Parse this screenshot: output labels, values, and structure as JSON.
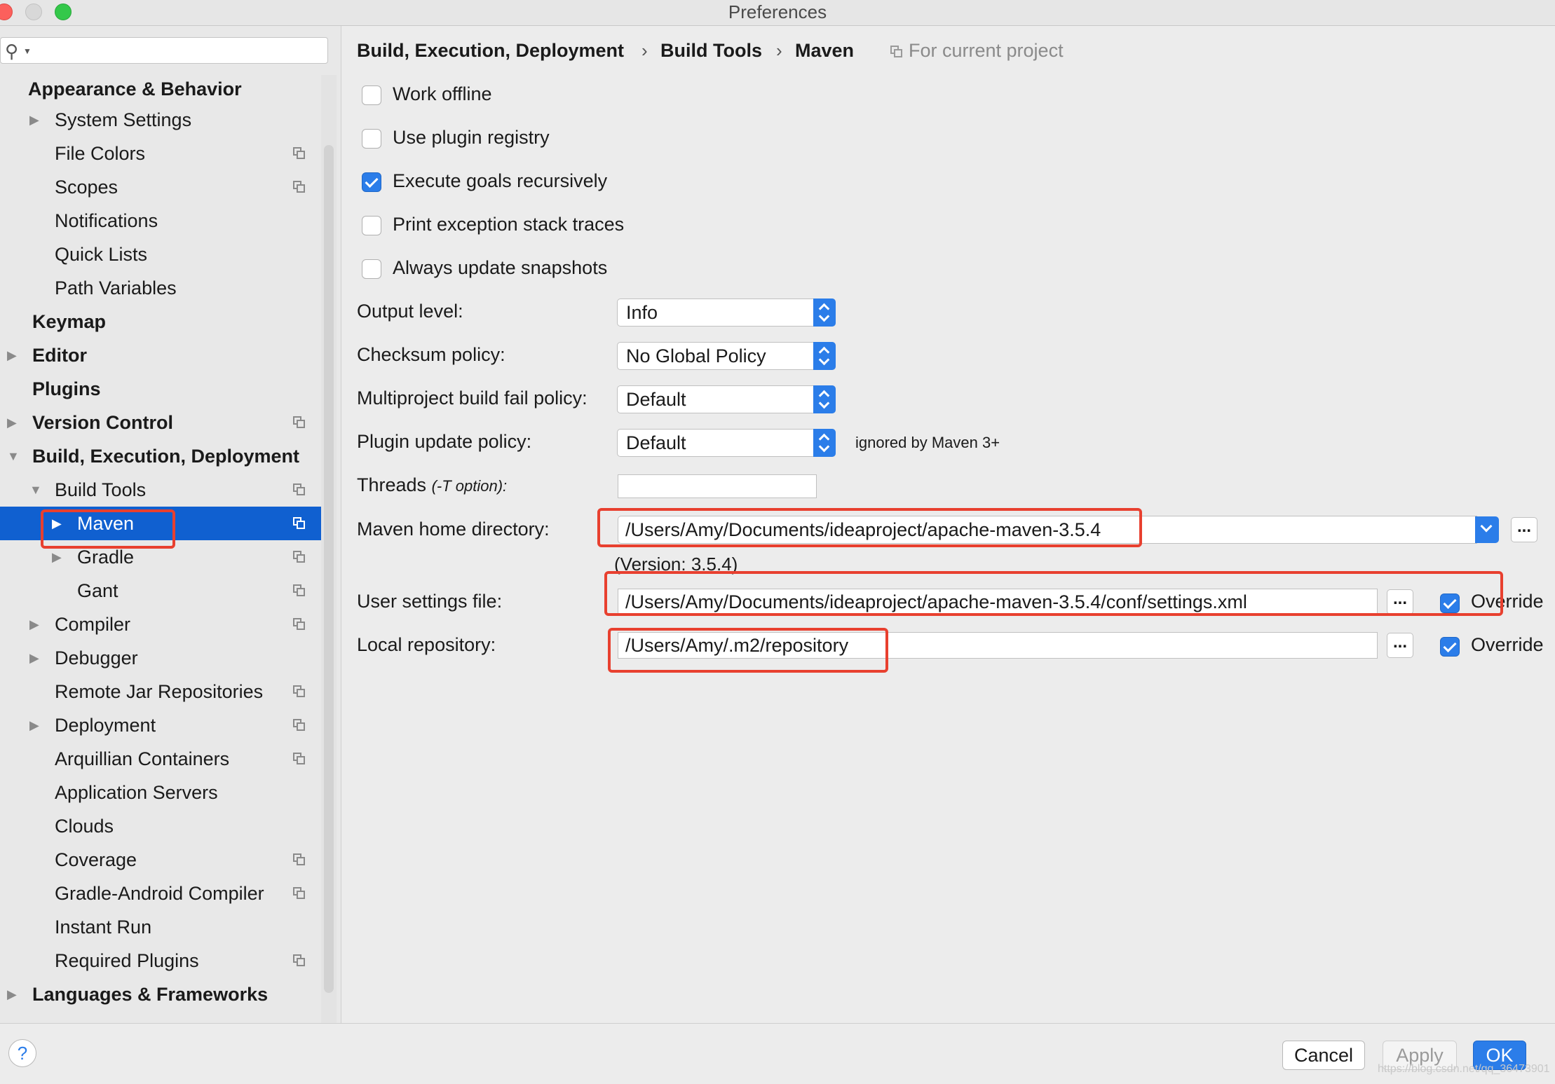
{
  "window": {
    "title": "Preferences"
  },
  "search": {
    "placeholder": ""
  },
  "sidebar": {
    "items": [
      {
        "label": "Appearance & Behavior"
      },
      {
        "label": "System Settings"
      },
      {
        "label": "File Colors"
      },
      {
        "label": "Scopes"
      },
      {
        "label": "Notifications"
      },
      {
        "label": "Quick Lists"
      },
      {
        "label": "Path Variables"
      },
      {
        "label": "Keymap"
      },
      {
        "label": "Editor"
      },
      {
        "label": "Plugins"
      },
      {
        "label": "Version Control"
      },
      {
        "label": "Build, Execution, Deployment"
      },
      {
        "label": "Build Tools"
      },
      {
        "label": "Maven"
      },
      {
        "label": "Gradle"
      },
      {
        "label": "Gant"
      },
      {
        "label": "Compiler"
      },
      {
        "label": "Debugger"
      },
      {
        "label": "Remote Jar Repositories"
      },
      {
        "label": "Deployment"
      },
      {
        "label": "Arquillian Containers"
      },
      {
        "label": "Application Servers"
      },
      {
        "label": "Clouds"
      },
      {
        "label": "Coverage"
      },
      {
        "label": "Gradle-Android Compiler"
      },
      {
        "label": "Instant Run"
      },
      {
        "label": "Required Plugins"
      },
      {
        "label": "Languages & Frameworks"
      }
    ]
  },
  "breadcrumb": {
    "items": [
      "Build, Execution, Deployment",
      "Build Tools",
      "Maven"
    ],
    "separator": "›",
    "scope": "For current project"
  },
  "options": {
    "work_offline": {
      "label": "Work offline",
      "checked": false
    },
    "use_plugin_registry": {
      "label": "Use plugin registry",
      "checked": false
    },
    "execute_goals_recursively": {
      "label": "Execute goals recursively",
      "checked": true
    },
    "print_exception_stack_traces": {
      "label": "Print exception stack traces",
      "checked": false
    },
    "always_update_snapshots": {
      "label": "Always update snapshots",
      "checked": false
    }
  },
  "fields": {
    "output_level": {
      "label": "Output level:",
      "value": "Info"
    },
    "checksum_policy": {
      "label": "Checksum policy:",
      "value": "No Global Policy"
    },
    "multiproject_fail_policy": {
      "label": "Multiproject build fail policy:",
      "value": "Default"
    },
    "plugin_update_policy": {
      "label": "Plugin update policy:",
      "value": "Default",
      "hint": "ignored by Maven 3+"
    },
    "threads": {
      "label": "Threads",
      "sublabel": "(-T option):",
      "value": ""
    },
    "maven_home": {
      "label": "Maven home directory:",
      "value": "/Users/Amy/Documents/ideaproject/apache-maven-3.5.4",
      "version": "(Version: 3.5.4)"
    },
    "user_settings": {
      "label": "User settings file:",
      "value": "/Users/Amy/Documents/ideaproject/apache-maven-3.5.4/conf/settings.xml",
      "override_label": "Override",
      "override": true
    },
    "local_repo": {
      "label": "Local repository:",
      "value": "/Users/Amy/.m2/repository",
      "override_label": "Override",
      "override": true
    },
    "browse_label": "..."
  },
  "footer": {
    "help": "?",
    "cancel": "Cancel",
    "apply": "Apply",
    "ok": "OK",
    "watermark": "https://blog.csdn.net/qq_36473901"
  },
  "colors": {
    "accent": "#2b7de9",
    "selection": "#1060d0",
    "annotation": "#e8402f"
  }
}
